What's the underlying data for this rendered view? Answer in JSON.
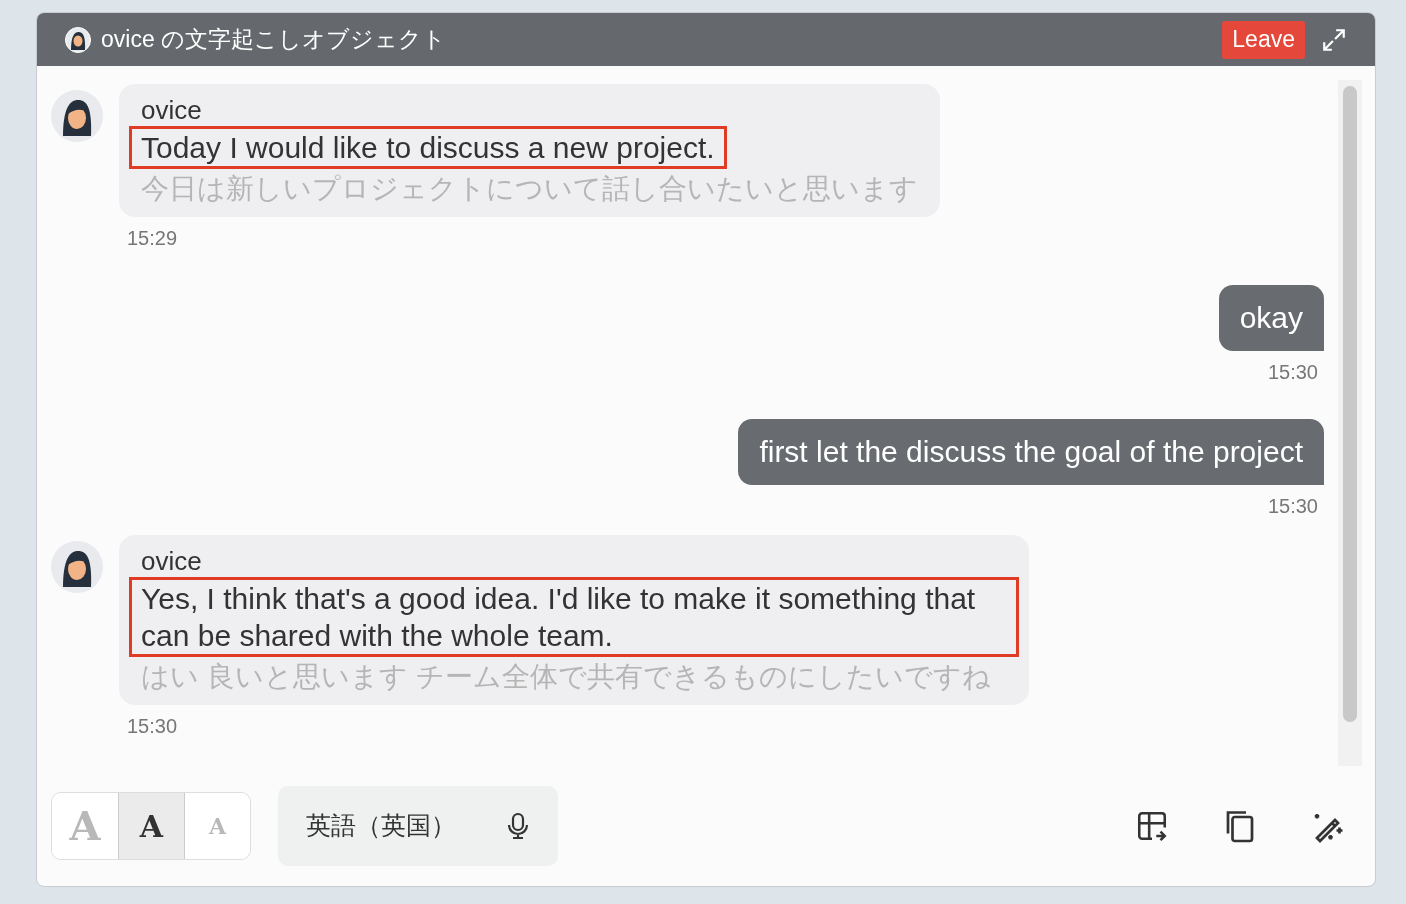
{
  "window": {
    "title": "ovice の文字起こしオブジェクト",
    "leave_button": "Leave"
  },
  "messages": [
    {
      "kind": "incoming",
      "sender": "ovice",
      "text": "Today I would like to discuss a new project.",
      "translation": "今日は新しいプロジェクトについて話し合いたいと思います",
      "time": "15:29",
      "highlighted": true
    },
    {
      "kind": "outgoing",
      "text": "okay",
      "time": "15:30"
    },
    {
      "kind": "outgoing",
      "text": "first let the discuss the goal of the project",
      "time": "15:30"
    },
    {
      "kind": "incoming",
      "sender": "ovice",
      "text": "Yes, I think that's a good idea. I'd like to make it something that can be shared with the whole team.",
      "translation": "はい 良いと思います チーム全体で共有できるものにしたいですね",
      "time": "15:30",
      "highlighted": true
    }
  ],
  "font_sizes": [
    {
      "kind": "large",
      "label": "A",
      "selected": false
    },
    {
      "kind": "medium",
      "label": "A",
      "selected": true
    },
    {
      "kind": "small",
      "label": "A",
      "selected": false
    }
  ],
  "language": {
    "value": "英語（英国）"
  }
}
